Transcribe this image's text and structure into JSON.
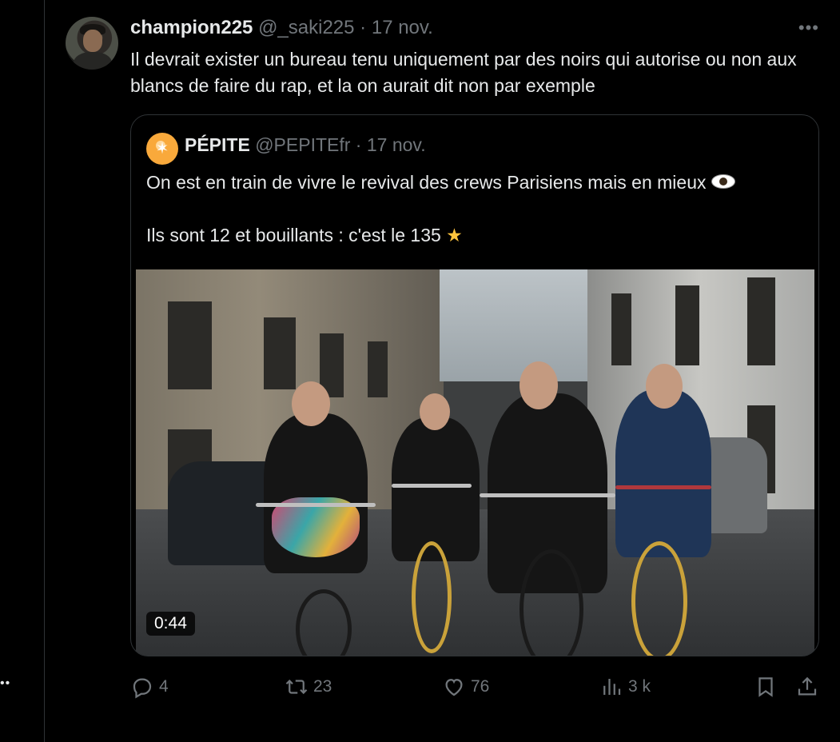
{
  "colors": {
    "background": "#000000",
    "text": "#e7e9ea",
    "muted": "#71767b",
    "border": "#2f3336",
    "quote_avatar": "#f9a93b"
  },
  "left_rail": {
    "more_icon": "more-dots-icon",
    "more_label": "••"
  },
  "tweet": {
    "author": {
      "display_name": "champion225",
      "handle": "@_saki225"
    },
    "separator": "·",
    "date": "17 nov.",
    "more_label": "•••",
    "text": "Il devrait exister un bureau tenu uniquement par des noirs qui autorise ou non aux blancs de faire du rap, et la on aurait dit non par exemple",
    "quote": {
      "author": {
        "display_name": "PÉPITE",
        "handle": "@PEPITEfr"
      },
      "separator": "·",
      "date": "17 nov.",
      "line1": "On est en train de vivre le revival des crews Parisiens mais en mieux",
      "line2": "Ils sont 12 et bouillants : c'est le 135",
      "line1_emoji": "eye-emoji",
      "line2_emoji": "★",
      "video": {
        "duration": "0:44"
      }
    },
    "actions": {
      "replies": "4",
      "reposts": "23",
      "likes": "76",
      "views": "3 k",
      "icons": [
        "reply-icon",
        "repost-icon",
        "like-icon",
        "views-icon",
        "bookmark-icon",
        "share-icon"
      ]
    }
  }
}
